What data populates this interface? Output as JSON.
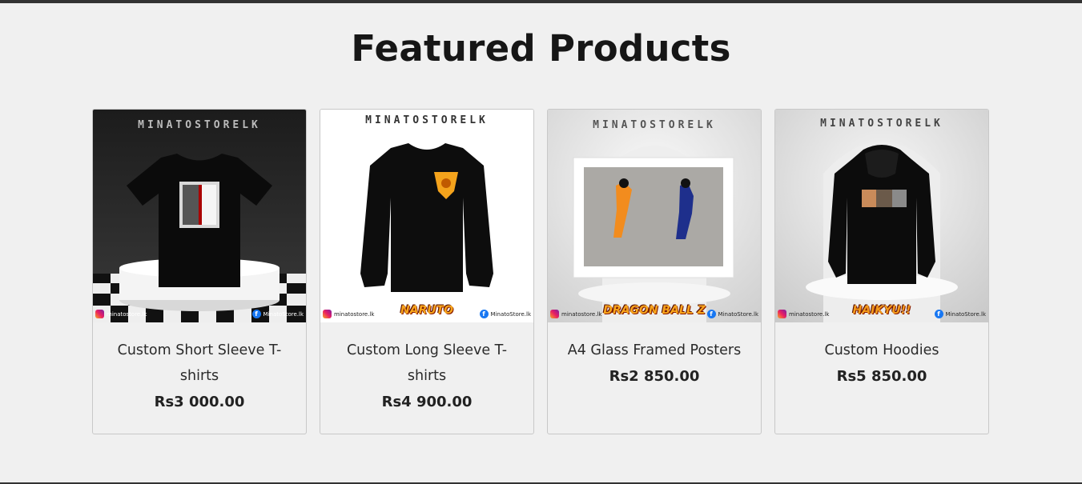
{
  "section": {
    "title": "Featured Products"
  },
  "brand_watermark": "MINATOSTORELK",
  "social": {
    "instagram": "minatostore.lk",
    "facebook": "MinatoStore.lk"
  },
  "products": [
    {
      "name": "Custom Short Sleeve T-shirts",
      "price": "Rs3 000.00",
      "image_icon": "black-tshirt-image",
      "logo": ""
    },
    {
      "name": "Custom Long Sleeve T-shirts",
      "price": "Rs4 900.00",
      "image_icon": "long-sleeve-shirt-image",
      "logo": "NARUTO"
    },
    {
      "name": "A4 Glass Framed Posters",
      "price": "Rs2 850.00",
      "image_icon": "framed-poster-image",
      "logo": "DRAGON BALL Z"
    },
    {
      "name": "Custom Hoodies",
      "price": "Rs5 850.00",
      "image_icon": "hoodie-image",
      "logo": "HAIKYU!!"
    }
  ],
  "colors": {
    "background": "#f0f0f0",
    "text": "#1a1a1a",
    "border": "#c8c8c8"
  }
}
